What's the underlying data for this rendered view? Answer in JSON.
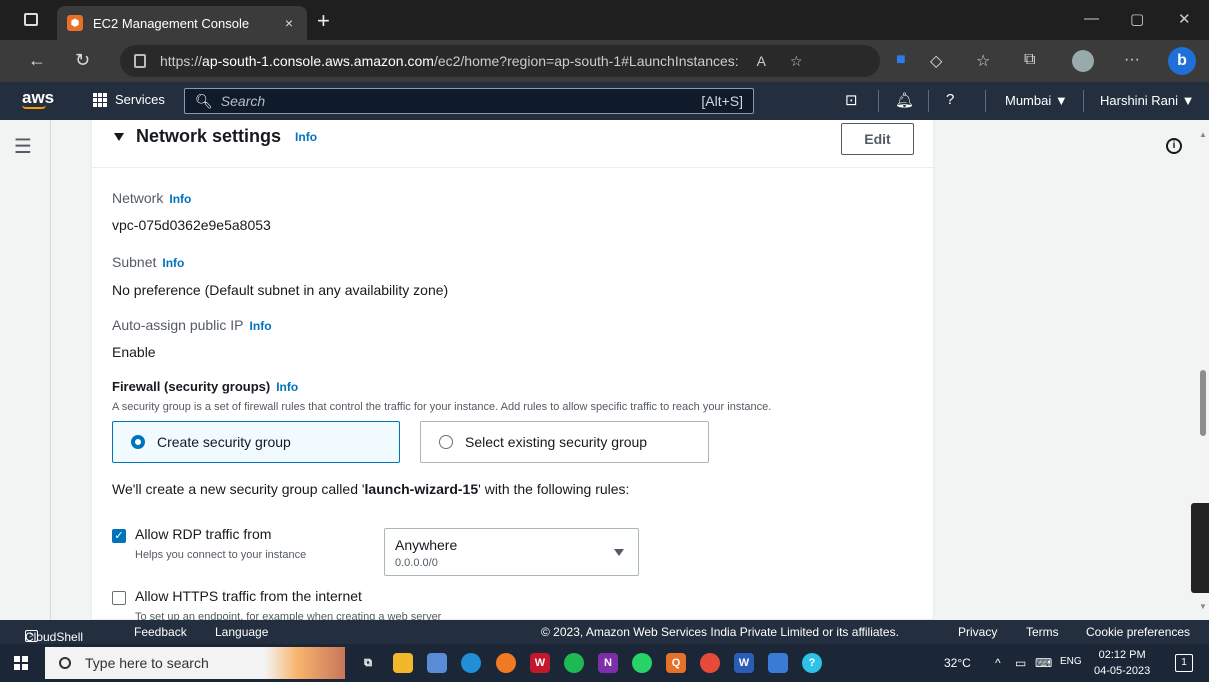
{
  "browser": {
    "tab_title": "EC2 Management Console",
    "tab_close": "×",
    "new_tab": "+",
    "url_prefix": "https://",
    "url_host": "ap-south-1.console.aws.amazon.com",
    "url_path": "/ec2/home?region=ap-south-1#LaunchInstances:",
    "win_min": "—",
    "win_max": "▢",
    "win_close": "✕"
  },
  "aws_header": {
    "logo": "aws",
    "services": "Services",
    "search_placeholder": "Search",
    "search_shortcut": "[Alt+S]",
    "region": "Mumbai ▼",
    "user": "Harshini Rani ▼"
  },
  "panel": {
    "title": "Network settings",
    "title_info": "Info",
    "edit_label": "Edit",
    "network_label": "Network",
    "network_info": "Info",
    "network_value": "vpc-075d0362e9e5a8053",
    "subnet_label": "Subnet",
    "subnet_info": "Info",
    "subnet_value": "No preference (Default subnet in any availability zone)",
    "public_ip_label": "Auto-assign public IP",
    "public_ip_info": "Info",
    "public_ip_value": "Enable",
    "firewall_title": "Firewall (security groups)",
    "firewall_info": "Info",
    "firewall_desc": "A security group is a set of firewall rules that control the traffic for your instance. Add rules to allow specific traffic to reach your instance.",
    "option_create": "Create security group",
    "option_existing": "Select existing security group",
    "sg_note_prefix": "We'll create a new security group called '",
    "sg_name": "launch-wizard-15",
    "sg_note_suffix": "' with the following rules:",
    "rdp_label": "Allow RDP traffic from",
    "rdp_help": "Helps you connect to your instance",
    "rdp_checked": true,
    "rdp_source": "Anywhere",
    "rdp_source_cidr": "0.0.0.0/0",
    "https_label": "Allow HTTPS traffic from the internet",
    "https_help": "To set up an endpoint, for example when creating a web server",
    "https_checked": false
  },
  "footer": {
    "cloudshell": "CloudShell",
    "feedback": "Feedback",
    "language": "Language",
    "copyright": "© 2023, Amazon Web Services India Private Limited or its affiliates.",
    "privacy": "Privacy",
    "terms": "Terms",
    "cookies": "Cookie preferences"
  },
  "taskbar": {
    "search_placeholder": "Type here to search",
    "weather": "32°C",
    "lang": "ENG",
    "time": "02:12 PM",
    "date": "04-05-2023",
    "notif_count": "1"
  },
  "colors": {
    "aws_header": "#232f3e",
    "accent": "#0073bb",
    "aws_orange": "#ff9900"
  }
}
